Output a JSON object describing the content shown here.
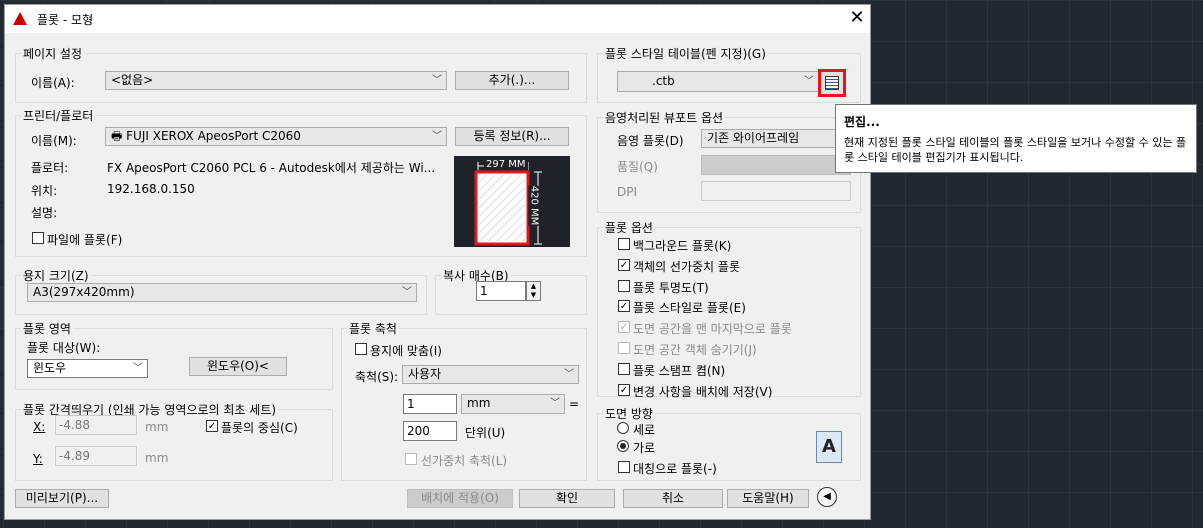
{
  "title": "플롯 - 모형",
  "page_setup": {
    "group": "페이지 설정",
    "name_label": "이름(A):",
    "name_value": "<없음>",
    "add_button": "추가(.)..."
  },
  "printer": {
    "group": "프린터/플로터",
    "name_label": "이름(M):",
    "name_value": "FUJI XEROX ApeosPort C2060",
    "props_button": "등록 정보(R)...",
    "plotter_label": "플로터:",
    "plotter_value": "FX ApeosPort C2060 PCL 6 - Autodesk에서 제공하는 Wi...",
    "where_label": "위치:",
    "where_value": "192.168.0.150",
    "desc_label": "설명:",
    "plot_to_file": "파일에 플롯(F)",
    "preview_width": "297 MM",
    "preview_height": "420 MM"
  },
  "paper": {
    "group": "용지 크기(Z)",
    "value": "A3(297x420mm)"
  },
  "copies": {
    "group": "복사 매수(B)",
    "value": "1"
  },
  "area": {
    "group": "플롯 영역",
    "what_label": "플롯 대상(W):",
    "what_value": "윈도우",
    "window_button": "윈도우(O)<"
  },
  "offset": {
    "group": "플롯 간격띄우기 (인쇄 가능 영역으로의 최초 세트)",
    "x_label": "X:",
    "x_value": "-4.88",
    "x_unit": "mm",
    "center": "플롯의 중심(C)",
    "y_label": "Y:",
    "y_value": "-4.89",
    "y_unit": "mm"
  },
  "scale": {
    "group": "플롯 축척",
    "fit": "용지에 맞춤(I)",
    "scale_label": "축척(S):",
    "scale_value": "사용자",
    "val1": "1",
    "unit": "mm",
    "eq": "=",
    "val2": "200",
    "unit2": "단위(U)",
    "lineweights": "선가중치 축척(L)"
  },
  "style_table": {
    "group": "플롯 스타일 테이블(펜 지정)(G)",
    "value": ".ctb"
  },
  "shaded": {
    "group": "음영처리된 뷰포트 옵션",
    "shade_label": "음영 플롯(D)",
    "shade_value": "기존 와이어프레임",
    "quality_label": "품질(Q)",
    "dpi_label": "DPI"
  },
  "options": {
    "group": "플롯 옵션",
    "items": [
      {
        "label": "백그라운드 플롯(K)",
        "checked": false
      },
      {
        "label": "객체의 선가중치 플롯",
        "checked": true
      },
      {
        "label": "플롯 투명도(T)",
        "checked": false
      },
      {
        "label": "플롯 스타일로 플롯(E)",
        "checked": true
      },
      {
        "label": "도면 공간을 맨 마지막으로 플롯",
        "checked": true
      },
      {
        "label": "도면 공간 객체 숨기기(J)",
        "checked": false
      },
      {
        "label": "플롯 스탬프 켬(N)",
        "checked": false
      },
      {
        "label": "변경 사항을 배치에 저장(V)",
        "checked": true
      }
    ]
  },
  "orientation": {
    "group": "도면 방향",
    "portrait": "세로",
    "landscape": "가로",
    "upside": "대칭으로 플롯(-)",
    "icon_letter": "A"
  },
  "footer": {
    "preview": "미리보기(P)...",
    "apply": "배치에 적용(O)",
    "ok": "확인",
    "cancel": "취소",
    "help": "도움말(H)"
  },
  "tooltip": {
    "title": "편집...",
    "text": "현재 지정된 플롯 스타일 테이블의 플롯 스타일을 보거나 수정할 수 있는 플롯 스타일 테이블 편집기가 표시됩니다."
  },
  "colors": {
    "highlight": "#e8141c",
    "preview_bg": "#1f2329"
  }
}
